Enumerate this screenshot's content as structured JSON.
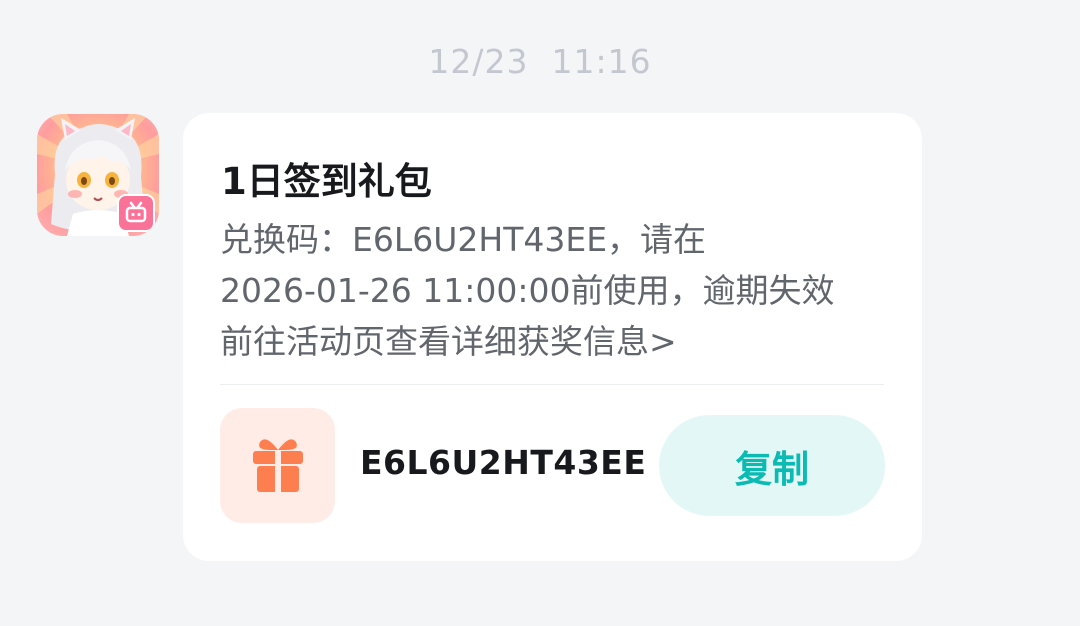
{
  "timestamp": "12/23  11:16",
  "sender": {
    "avatar_icon": "anime-character-avatar-icon",
    "badge_icon": "tv-app-badge-icon",
    "badge_color": "#fb7299"
  },
  "message": {
    "title": "1日签到礼包",
    "lines": [
      "兑换码：E6L6U2HT43EE，请在",
      "2026-01-26 11:00:00前使用，逾期失效",
      "前往活动页查看详细获奖信息>"
    ],
    "code": "E6L6U2HT43EE",
    "gift_icon": "gift-icon",
    "gift_color": "#fd7f4f",
    "copy_label": "复制",
    "accent_color": "#0bbab3"
  }
}
